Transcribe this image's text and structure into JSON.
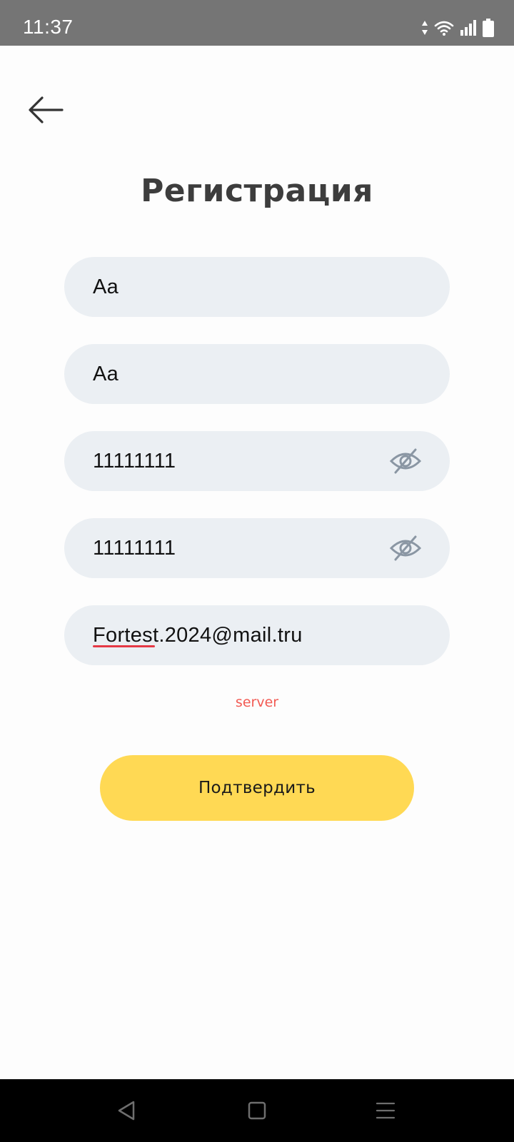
{
  "status_bar": {
    "time": "11:37",
    "icons": [
      "data-arrows-icon",
      "wifi-icon",
      "signal-icon",
      "battery-icon"
    ]
  },
  "header": {
    "back_icon": "arrow-left-icon",
    "title": "Регистрация"
  },
  "form": {
    "fields": [
      {
        "value": "Aa"
      },
      {
        "value": "Aa"
      },
      {
        "value": "11111111",
        "icon": "eye-off-icon"
      },
      {
        "value": "11111111",
        "icon": "eye-off-icon"
      },
      {
        "value": "Fortest.2024@mail.tru",
        "spellcheck_word": "Fortest"
      }
    ],
    "error": "server",
    "submit_label": "Подтвердить"
  },
  "nav_bar": {
    "icons": [
      "back-triangle-icon",
      "home-square-icon",
      "menu-lines-icon"
    ]
  },
  "colors": {
    "accent": "#ffd954",
    "field_bg": "#ebeff3",
    "error": "#f25a53",
    "title": "#3d3d3d"
  }
}
